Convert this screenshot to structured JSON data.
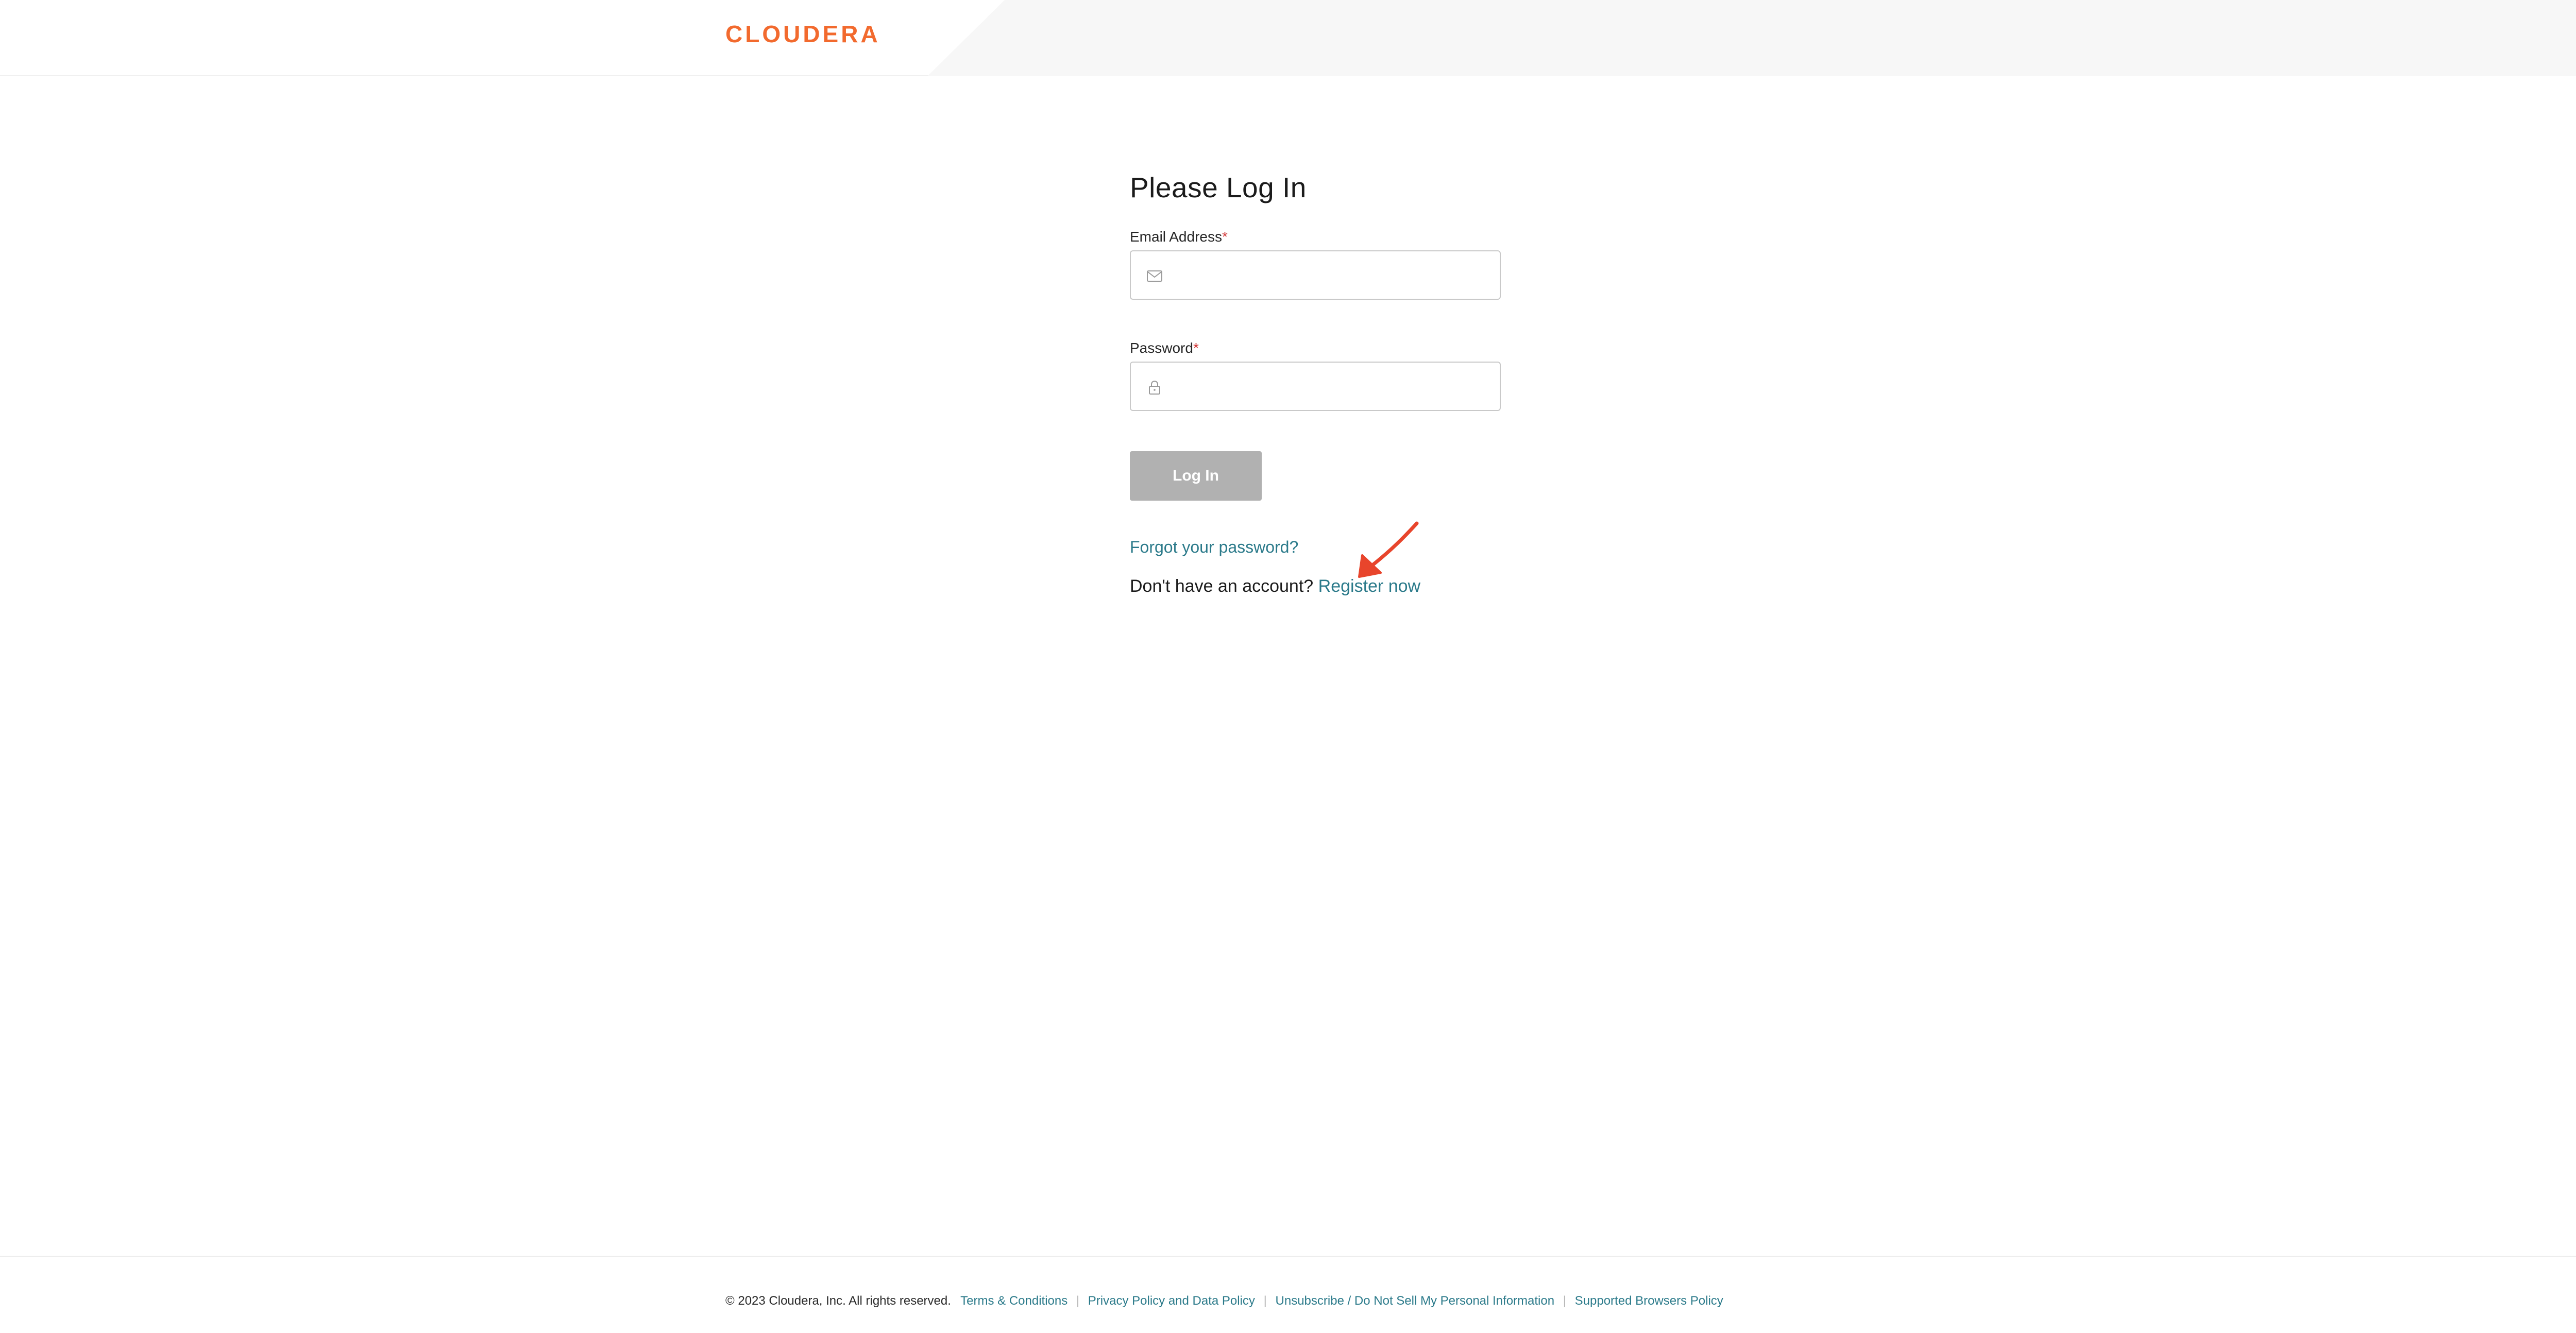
{
  "header": {
    "logo_text": "CLOUDERA",
    "brand_color": "#f26a2e"
  },
  "form": {
    "title": "Please Log In",
    "email": {
      "label": "Email Address",
      "required_mark": "*",
      "value": "",
      "icon": "envelope-icon"
    },
    "password": {
      "label": "Password",
      "required_mark": "*",
      "value": "",
      "icon": "lock-icon"
    },
    "login_label": "Log In",
    "login_disabled": true,
    "forgot_link": "Forgot your password?",
    "register_prompt": "Don't have an account? ",
    "register_link": "Register now"
  },
  "annotation": {
    "icon": "red-arrow-icon",
    "color": "#e8452c"
  },
  "footer": {
    "copyright": "© 2023 Cloudera, Inc. All rights reserved.",
    "links": [
      "Terms & Conditions",
      "Privacy Policy and Data Policy",
      "Unsubscribe / Do Not Sell My Personal Information",
      "Supported Browsers Policy"
    ],
    "separator": "|"
  },
  "colors": {
    "link": "#2b7a8a",
    "button_disabled": "#b1b1b1",
    "required": "#d23b3b"
  }
}
